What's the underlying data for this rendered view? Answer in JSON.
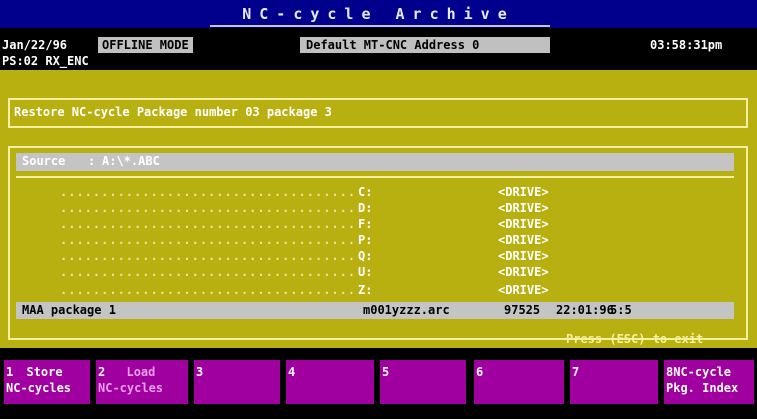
{
  "window": {
    "title": "NC-cycle Archive"
  },
  "status": {
    "date": "Jan/22/96",
    "mode": "OFFLINE MODE",
    "address": "Default MT-CNC Address 0",
    "time": "03:58:31pm",
    "ps_line": "PS:02 RX_ENC"
  },
  "restore": {
    "title": "Restore NC-cycle Package number 03 package 3"
  },
  "source": {
    "label": "Source",
    "separator": ":",
    "value": "A:\\*.ABC"
  },
  "drives": [
    {
      "dots": "....................................",
      "letter": "C:",
      "type": "<DRIVE>"
    },
    {
      "dots": "....................................",
      "letter": "D:",
      "type": "<DRIVE>"
    },
    {
      "dots": "....................................",
      "letter": "F:",
      "type": "<DRIVE>"
    },
    {
      "dots": "....................................",
      "letter": "P:",
      "type": "<DRIVE>"
    },
    {
      "dots": "....................................",
      "letter": "Q:",
      "type": "<DRIVE>"
    },
    {
      "dots": "....................................",
      "letter": "U:",
      "type": "<DRIVE>"
    },
    {
      "dots": "....................................",
      "letter": "Z:",
      "type": "<DRIVE>"
    }
  ],
  "selected": {
    "name": "MAA package 1",
    "file": "m001yzzz.arc",
    "size": "97525",
    "date": "22:01:96",
    "time": "5:5"
  },
  "footer": {
    "hint": "Press (ESC) to exit"
  },
  "fkeys": [
    {
      "num": "1",
      "line1": "Store",
      "line2": "NC-cycles"
    },
    {
      "num": "2",
      "line1": "Load",
      "line2": "NC-cycles"
    },
    {
      "num": "3",
      "line1": "",
      "line2": ""
    },
    {
      "num": "4",
      "line1": "",
      "line2": ""
    },
    {
      "num": "5",
      "line1": "",
      "line2": ""
    },
    {
      "num": "6",
      "line1": "",
      "line2": ""
    },
    {
      "num": "7",
      "line1": "",
      "line2": ""
    },
    {
      "num": "8",
      "line1": "NC-cycle",
      "line2": "Pkg. Index"
    }
  ]
}
